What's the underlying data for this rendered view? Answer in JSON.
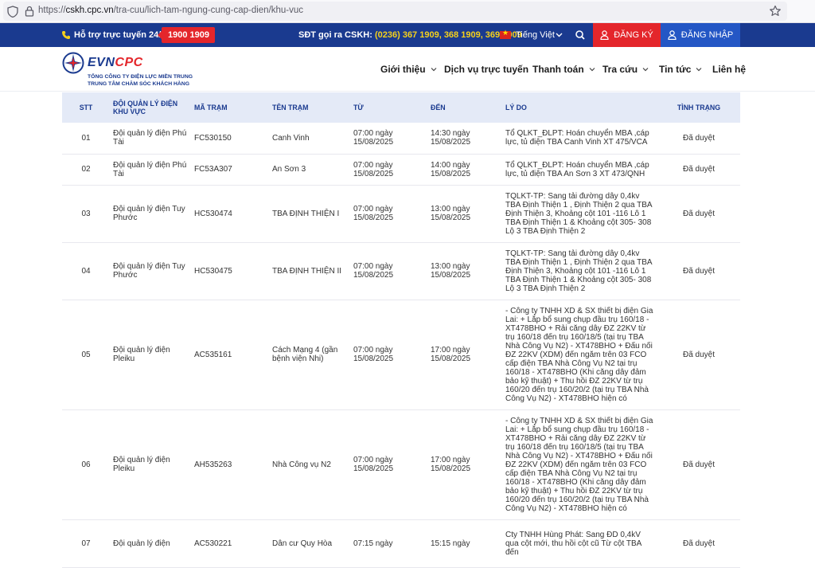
{
  "browser": {
    "url_prefix": "https://",
    "url_domain": "cskh.cpc.vn",
    "url_path": "/tra-cuu/lich-tam-ngung-cung-cap-dien/khu-vuc"
  },
  "topbar": {
    "hotline_label": "Hỗ trợ trực tuyến 24/7:",
    "hotline_number": "1900 1909",
    "cskh_label": "SĐT gọi ra CSKH:",
    "cskh_numbers": "(0236) 367 1909, 368 1909, 369 1909",
    "language": "Tiếng Việt",
    "register": "ĐĂNG KÝ",
    "login": "ĐĂNG NHẬP",
    "colors": {
      "bar": "#1a3a8f",
      "accent_red": "#e4262b",
      "login_blue": "#2457c5",
      "number_yellow": "#f6d11b"
    }
  },
  "logo": {
    "brand_evn": "EVN",
    "brand_cpc": "CPC",
    "line1": "TỔNG CÔNG TY ĐIỆN LỰC MIỀN TRUNG",
    "line2": "TRUNG TÂM CHĂM SÓC KHÁCH HÀNG"
  },
  "nav": {
    "items": [
      {
        "label": "Giới thiệu",
        "dropdown": true
      },
      {
        "label": "Dịch vụ trực tuyến",
        "dropdown": false
      },
      {
        "label": "Thanh toán",
        "dropdown": true
      },
      {
        "label": "Tra cứu",
        "dropdown": true
      },
      {
        "label": "Tin tức",
        "dropdown": true
      },
      {
        "label": "Liên hệ",
        "dropdown": false
      }
    ]
  },
  "table": {
    "headers": {
      "stt": "STT",
      "unit": "ĐỘI QUẢN LÝ ĐIỆN KHU VỰC",
      "code": "MÃ TRẠM",
      "name": "TÊN TRẠM",
      "from": "TỪ",
      "to": "ĐẾN",
      "reason": "LÝ DO",
      "status": "TÌNH TRẠNG"
    },
    "rows": [
      {
        "stt": "01",
        "unit": "Đội quản lý điện Phú Tài",
        "code": "FC530150",
        "name": "Canh Vinh",
        "from": "07:00 ngày 15/08/2025",
        "to": "14:30 ngày 15/08/2025",
        "reason": "Tổ QLKT_ĐLPT: Hoán chuyển MBA ,cáp lực, tủ điện TBA Canh Vinh XT 475/VCA",
        "status": "Đã duyệt"
      },
      {
        "stt": "02",
        "unit": "Đội quản lý điện Phú Tài",
        "code": "FC53A307",
        "name": "An Sơn 3",
        "from": "07:00 ngày 15/08/2025",
        "to": "14:00 ngày 15/08/2025",
        "reason": "Tổ QLKT_ĐLPT: Hoán chuyển MBA ,cáp lực, tủ điện TBA An Sơn 3 XT 473/QNH",
        "status": "Đã duyệt"
      },
      {
        "stt": "03",
        "unit": "Đội quản lý điện Tuy Phước",
        "code": "HC530474",
        "name": "TBA ĐỊNH THIỆN I",
        "from": "07:00 ngày 15/08/2025",
        "to": "13:00 ngày 15/08/2025",
        "reason": "TQLKT-TP: Sang tải đường dây 0,4kv TBA Định Thiện 1 , Định Thiện 2 qua TBA Định Thiện 3, Khoảng cột 101 -116 Lô 1 TBA Định Thiện 1 & Khoảng cột 305- 308 Lộ 3 TBA Định Thiện 2",
        "status": "Đã duyệt"
      },
      {
        "stt": "04",
        "unit": "Đội quản lý điện Tuy Phước",
        "code": "HC530475",
        "name": "TBA ĐỊNH THIỆN II",
        "from": "07:00 ngày 15/08/2025",
        "to": "13:00 ngày 15/08/2025",
        "reason": "TQLKT-TP: Sang tải đường dây 0,4kv TBA Định Thiện 1 , Định Thiện 2 qua TBA Định Thiện 3, Khoảng cột 101 -116 Lô 1 TBA Định Thiện 1 & Khoảng cột 305- 308 Lộ 3 TBA Định Thiện 2",
        "status": "Đã duyệt"
      },
      {
        "stt": "05",
        "unit": "Đội quản lý điện Pleiku",
        "code": "AC535161",
        "name": "Cách Mạng 4 (gần bệnh viện Nhi)",
        "from": "07:00 ngày 15/08/2025",
        "to": "17:00 ngày 15/08/2025",
        "reason": "- Công ty TNHH XD & SX thiết bị điện Gia Lai: + Lắp bổ sung chụp đầu trụ 160/18 - XT478BHO + Rải căng dây ĐZ 22KV từ trụ 160/18 đến trụ 160/18/5 (tại trụ TBA Nhà Công Vụ N2) - XT478BHO + Đấu nối ĐZ 22KV (XDM) đến ngăm trên 03 FCO cấp điện TBA Nhà Công Vụ N2 tại trụ 160/18 - XT478BHO (Khi căng dây đảm bảo kỹ thuật) + Thu hồi ĐZ 22KV từ trụ 160/20 đến trụ 160/20/2 (tại trụ TBA Nhà Công Vụ N2) - XT478BHO hiện có",
        "status": "Đã duyệt"
      },
      {
        "stt": "06",
        "unit": "Đội quản lý điện Pleiku",
        "code": "AH535263",
        "name": "Nhà Công vụ N2",
        "from": "07:00 ngày 15/08/2025",
        "to": "17:00 ngày 15/08/2025",
        "reason": "- Công ty TNHH XD & SX thiết bị điện Gia Lai: + Lắp bổ sung chụp đầu trụ 160/18 - XT478BHO + Rải căng dây ĐZ 22KV từ trụ 160/18 đến trụ 160/18/5 (tại trụ TBA Nhà Công Vụ N2) - XT478BHO + Đấu nối ĐZ 22KV (XDM) đến ngăm trên 03 FCO cấp điện TBA Nhà Công Vụ N2 tại trụ 160/18 - XT478BHO (Khi căng dây đảm bảo kỹ thuật) + Thu hồi ĐZ 22KV từ trụ 160/20 đến trụ 160/20/2 (tại trụ TBA Nhà Công Vụ N2) - XT478BHO hiện có",
        "status": "Đã duyệt"
      },
      {
        "stt": "07",
        "unit": "Đội quản lý điện",
        "code": "AC530221",
        "name": "Dân cư Quy Hòa",
        "from": "07:15 ngày",
        "to": "15:15 ngày",
        "reason": "Cty TNHH Hùng Phát: Sang ĐD 0,4kV qua cột mới, thu hồi cột cũ Từ cột TBA đến",
        "status": "Đã duyệt"
      }
    ]
  }
}
